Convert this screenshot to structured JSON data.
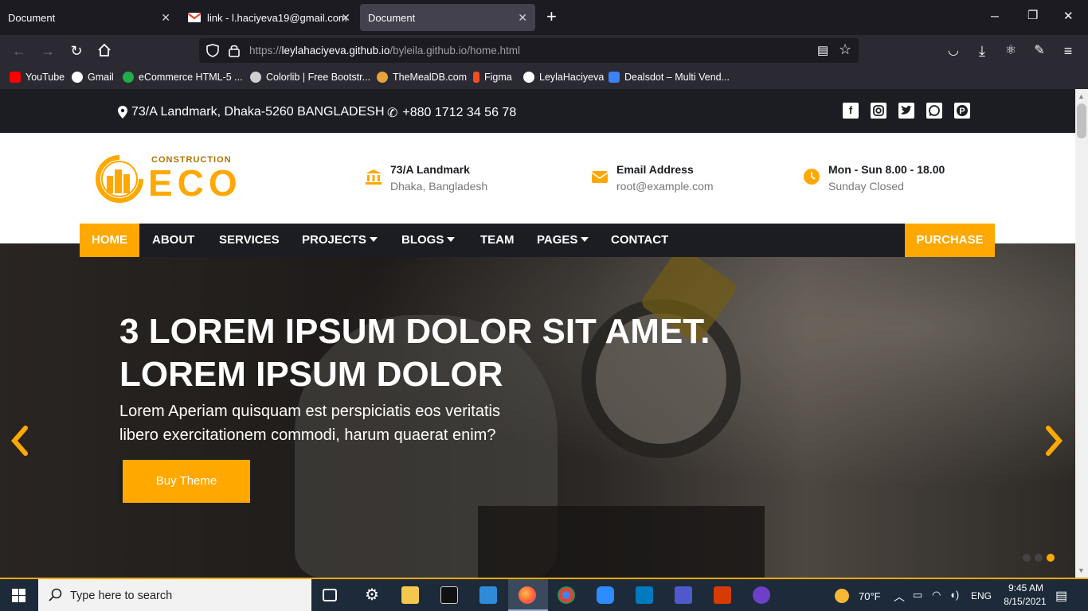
{
  "browser": {
    "tabs": [
      {
        "title": "Document",
        "active": false
      },
      {
        "title": "link - l.haciyeva19@gmail.com",
        "active": false
      },
      {
        "title": "Document",
        "active": true
      }
    ],
    "new_tab": "+",
    "url_prefix": "https://",
    "url_host": "leylahaciyeva.github.io",
    "url_path": "/byleila.github.io/home.html",
    "bookmarks": [
      {
        "label": "YouTube",
        "color": "#ff0000"
      },
      {
        "label": "Gmail",
        "color": "#ffffff"
      },
      {
        "label": "eCommerce HTML-5 ...",
        "color": "#1fae4b"
      },
      {
        "label": "Colorlib | Free Bootstr...",
        "color": "#cfcfcf"
      },
      {
        "label": "TheMealDB.com",
        "color": "#e8a33a"
      },
      {
        "label": "Figma",
        "color": "#f24e1e"
      },
      {
        "label": "LeylaHaciyeva",
        "color": "#ffffff"
      },
      {
        "label": "Dealsdot – Multi Vend...",
        "color": "#3b82f6"
      }
    ]
  },
  "site": {
    "topbar": {
      "address": "73/A Landmark, Dhaka-5260 BANGLADESH",
      "phone": "+880 1712 34 56 78",
      "social": [
        "facebook",
        "instagram",
        "twitter",
        "whatsapp",
        "pinterest"
      ]
    },
    "logo": {
      "top": "CONSTRUCTION",
      "main": "ECO"
    },
    "info": [
      {
        "title": "73/A Landmark",
        "sub": "Dhaka, Bangladesh",
        "icon": "bank-icon"
      },
      {
        "title": "Email Address",
        "sub": "root@example.com",
        "icon": "envelope-icon"
      },
      {
        "title": "Mon - Sun 8.00 - 18.00",
        "sub": "Sunday Closed",
        "icon": "clock-icon"
      }
    ],
    "menu": {
      "items": [
        {
          "label": "HOME",
          "dropdown": false
        },
        {
          "label": "ABOUT",
          "dropdown": false
        },
        {
          "label": "SERVICES",
          "dropdown": false
        },
        {
          "label": "PROJECTS",
          "dropdown": true
        },
        {
          "label": "BLOGS",
          "dropdown": true
        },
        {
          "label": "TEAM",
          "dropdown": false
        },
        {
          "label": "PAGES",
          "dropdown": true
        },
        {
          "label": "CONTACT",
          "dropdown": false
        }
      ],
      "purchase": "PURCHASE"
    },
    "hero": {
      "title_line1": "3 LOREM IPSUM DOLOR SIT AMET.",
      "title_line2": "LOREM IPSUM DOLOR",
      "sub_line1": "Lorem Aperiam quisquam est perspiciatis eos veritatis",
      "sub_line2": "libero exercitationem commodi, harum quaerat enim?",
      "button": "Buy Theme",
      "slides": 3,
      "active_slide": 3
    },
    "accent": "#ffa800"
  },
  "taskbar": {
    "search_placeholder": "Type here to search",
    "weather": "70°F",
    "lang": "ENG",
    "time": "9:45 AM",
    "date": "8/15/2021"
  }
}
